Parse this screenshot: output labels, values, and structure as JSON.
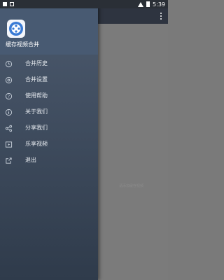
{
  "status_bar": {
    "time": "5:39"
  },
  "background": {
    "empty_text": "请添加缓存视频"
  },
  "drawer": {
    "app_name": "缓存视频合并",
    "menu": [
      {
        "label": "合并历史",
        "icon": "history-icon"
      },
      {
        "label": "合并设置",
        "icon": "settings-icon"
      },
      {
        "label": "使用帮助",
        "icon": "help-icon"
      },
      {
        "label": "关于我们",
        "icon": "info-icon"
      },
      {
        "label": "分享我们",
        "icon": "share-icon"
      },
      {
        "label": "乐享视频",
        "icon": "video-icon"
      },
      {
        "label": "退出",
        "icon": "exit-icon"
      }
    ]
  }
}
